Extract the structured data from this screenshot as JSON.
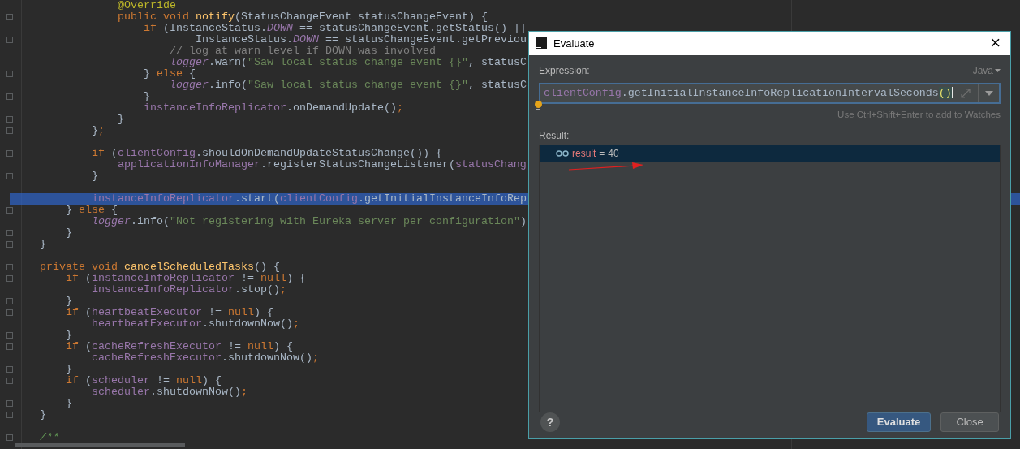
{
  "editor": {
    "lines": [
      {
        "fold": false,
        "segments": [
          {
            "kind": "annotation",
            "text": "                  @Override"
          }
        ]
      },
      {
        "fold": true,
        "segments": [
          {
            "kind": "kw",
            "text": "                  public void "
          },
          {
            "kind": "fn",
            "text": "notify"
          },
          {
            "kind": "plain",
            "text": "(StatusChangeEvent statusChangeEvent) {"
          }
        ]
      },
      {
        "fold": false,
        "segments": [
          {
            "kind": "kw",
            "text": "                      if "
          },
          {
            "kind": "plain",
            "text": "(InstanceStatus."
          },
          {
            "kind": "static",
            "text": "DOWN"
          },
          {
            "kind": "plain",
            "text": " == statusChangeEvent.getStatus() ||"
          }
        ]
      },
      {
        "fold": true,
        "segments": [
          {
            "kind": "plain",
            "text": "                              InstanceStatus."
          },
          {
            "kind": "static",
            "text": "DOWN"
          },
          {
            "kind": "plain",
            "text": " == statusChangeEvent.getPreviou"
          }
        ]
      },
      {
        "fold": false,
        "segments": [
          {
            "kind": "comment",
            "text": "                          // log at warn level if DOWN was involved"
          }
        ]
      },
      {
        "fold": false,
        "segments": [
          {
            "kind": "static",
            "text": "                          logger"
          },
          {
            "kind": "plain",
            "text": ".warn("
          },
          {
            "kind": "string",
            "text": "\"Saw local status change event {}\""
          },
          {
            "kind": "plain",
            "text": ", statusC"
          }
        ]
      },
      {
        "fold": true,
        "segments": [
          {
            "kind": "plain",
            "text": "                      } "
          },
          {
            "kind": "kw",
            "text": "else "
          },
          {
            "kind": "plain",
            "text": "{"
          }
        ]
      },
      {
        "fold": false,
        "segments": [
          {
            "kind": "static",
            "text": "                          logger"
          },
          {
            "kind": "plain",
            "text": ".info("
          },
          {
            "kind": "string",
            "text": "\"Saw local status change event {}\""
          },
          {
            "kind": "plain",
            "text": ", statusC"
          }
        ]
      },
      {
        "fold": true,
        "segments": [
          {
            "kind": "plain",
            "text": "                      }"
          }
        ]
      },
      {
        "fold": false,
        "segments": [
          {
            "kind": "field",
            "text": "                      instanceInfoReplicator"
          },
          {
            "kind": "plain",
            "text": ".onDemandUpdate()"
          },
          {
            "kind": "kw",
            "text": ";"
          }
        ]
      },
      {
        "fold": true,
        "segments": [
          {
            "kind": "plain",
            "text": "                  }"
          }
        ]
      },
      {
        "fold": true,
        "segments": [
          {
            "kind": "plain",
            "text": "              }"
          },
          {
            "kind": "kw",
            "text": ";"
          }
        ]
      },
      {
        "fold": false
      },
      {
        "fold": true,
        "segments": [
          {
            "kind": "kw",
            "text": "              if "
          },
          {
            "kind": "plain",
            "text": "("
          },
          {
            "kind": "field",
            "text": "clientConfig"
          },
          {
            "kind": "plain",
            "text": ".shouldOnDemandUpdateStatusChange()) {"
          }
        ]
      },
      {
        "fold": false,
        "segments": [
          {
            "kind": "field",
            "text": "                  applicationInfoManager"
          },
          {
            "kind": "plain",
            "text": ".registerStatusChangeListener("
          },
          {
            "kind": "field",
            "text": "statusChang"
          }
        ]
      },
      {
        "fold": true,
        "segments": [
          {
            "kind": "plain",
            "text": "              }"
          }
        ]
      },
      {
        "fold": false
      },
      {
        "fold": false,
        "highlighted": true,
        "segments": [
          {
            "kind": "field",
            "text": "              instanceInfoReplicator"
          },
          {
            "kind": "plain",
            "text": ".start("
          },
          {
            "kind": "field",
            "text": "clientConfig"
          },
          {
            "kind": "plain",
            "text": ".getInitialInstanceInfoRep"
          }
        ]
      },
      {
        "fold": true,
        "segments": [
          {
            "kind": "plain",
            "text": "          } "
          },
          {
            "kind": "kw",
            "text": "else "
          },
          {
            "kind": "plain",
            "text": "{"
          }
        ]
      },
      {
        "fold": false,
        "segments": [
          {
            "kind": "static",
            "text": "              logger"
          },
          {
            "kind": "plain",
            "text": ".info("
          },
          {
            "kind": "string",
            "text": "\"Not registering with Eureka server per configuration\""
          },
          {
            "kind": "plain",
            "text": ")"
          }
        ]
      },
      {
        "fold": true,
        "segments": [
          {
            "kind": "plain",
            "text": "          }"
          }
        ]
      },
      {
        "fold": true,
        "segments": [
          {
            "kind": "plain",
            "text": "      }"
          }
        ]
      },
      {
        "fold": false
      },
      {
        "fold": true,
        "segments": [
          {
            "kind": "kw",
            "text": "      private void "
          },
          {
            "kind": "fn",
            "text": "cancelScheduledTasks"
          },
          {
            "kind": "plain",
            "text": "() {"
          }
        ]
      },
      {
        "fold": true,
        "segments": [
          {
            "kind": "kw",
            "text": "          if "
          },
          {
            "kind": "plain",
            "text": "("
          },
          {
            "kind": "field",
            "text": "instanceInfoReplicator"
          },
          {
            "kind": "plain",
            "text": " != "
          },
          {
            "kind": "kw",
            "text": "null"
          },
          {
            "kind": "plain",
            "text": ") {"
          }
        ]
      },
      {
        "fold": false,
        "segments": [
          {
            "kind": "field",
            "text": "              instanceInfoReplicator"
          },
          {
            "kind": "plain",
            "text": ".stop()"
          },
          {
            "kind": "kw",
            "text": ";"
          }
        ]
      },
      {
        "fold": true,
        "segments": [
          {
            "kind": "plain",
            "text": "          }"
          }
        ]
      },
      {
        "fold": true,
        "segments": [
          {
            "kind": "kw",
            "text": "          if "
          },
          {
            "kind": "plain",
            "text": "("
          },
          {
            "kind": "field",
            "text": "heartbeatExecutor"
          },
          {
            "kind": "plain",
            "text": " != "
          },
          {
            "kind": "kw",
            "text": "null"
          },
          {
            "kind": "plain",
            "text": ") {"
          }
        ]
      },
      {
        "fold": false,
        "segments": [
          {
            "kind": "field",
            "text": "              heartbeatExecutor"
          },
          {
            "kind": "plain",
            "text": ".shutdownNow()"
          },
          {
            "kind": "kw",
            "text": ";"
          }
        ]
      },
      {
        "fold": true,
        "segments": [
          {
            "kind": "plain",
            "text": "          }"
          }
        ]
      },
      {
        "fold": true,
        "segments": [
          {
            "kind": "kw",
            "text": "          if "
          },
          {
            "kind": "plain",
            "text": "("
          },
          {
            "kind": "field",
            "text": "cacheRefreshExecutor"
          },
          {
            "kind": "plain",
            "text": " != "
          },
          {
            "kind": "kw",
            "text": "null"
          },
          {
            "kind": "plain",
            "text": ") {"
          }
        ]
      },
      {
        "fold": false,
        "segments": [
          {
            "kind": "field",
            "text": "              cacheRefreshExecutor"
          },
          {
            "kind": "plain",
            "text": ".shutdownNow()"
          },
          {
            "kind": "kw",
            "text": ";"
          }
        ]
      },
      {
        "fold": true,
        "segments": [
          {
            "kind": "plain",
            "text": "          }"
          }
        ]
      },
      {
        "fold": true,
        "segments": [
          {
            "kind": "kw",
            "text": "          if "
          },
          {
            "kind": "plain",
            "text": "("
          },
          {
            "kind": "field",
            "text": "scheduler"
          },
          {
            "kind": "plain",
            "text": " != "
          },
          {
            "kind": "kw",
            "text": "null"
          },
          {
            "kind": "plain",
            "text": ") {"
          }
        ]
      },
      {
        "fold": false,
        "segments": [
          {
            "kind": "field",
            "text": "              scheduler"
          },
          {
            "kind": "plain",
            "text": ".shutdownNow()"
          },
          {
            "kind": "kw",
            "text": ";"
          }
        ]
      },
      {
        "fold": true,
        "segments": [
          {
            "kind": "plain",
            "text": "          }"
          }
        ]
      },
      {
        "fold": true,
        "segments": [
          {
            "kind": "plain",
            "text": "      }"
          }
        ]
      },
      {
        "fold": false
      },
      {
        "fold": true,
        "segments": [
          {
            "kind": "doc",
            "text": "      /**"
          }
        ]
      }
    ]
  },
  "dialog": {
    "title": "Evaluate",
    "close": "×",
    "expression_label": "Expression:",
    "language": "Java",
    "expression": [
      {
        "kind": "field",
        "text": "clientConfig"
      },
      {
        "kind": "plain",
        "text": ".getInitialInstanceInfoReplicationIntervalSeconds"
      },
      {
        "kind": "paren",
        "text": "()"
      }
    ],
    "hint": "Use Ctrl+Shift+Enter to add to Watches",
    "result_label": "Result:",
    "result": {
      "name": "result",
      "equals": "=",
      "value": "40",
      "selected": true
    },
    "help": "?",
    "buttons": [
      {
        "label": "Evaluate",
        "primary": true
      },
      {
        "label": "Close",
        "primary": false
      }
    ]
  }
}
